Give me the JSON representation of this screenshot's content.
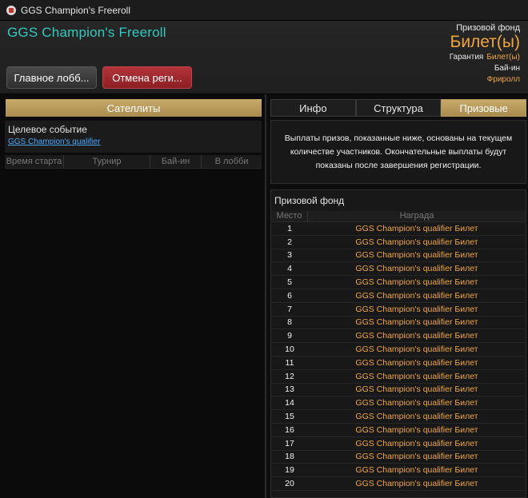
{
  "window": {
    "title": "GGS Champion's Freeroll"
  },
  "header": {
    "tournament_name": "GGS Champion's Freeroll",
    "lobby_button": "Главное лобб...",
    "cancel_button": "Отмена реги...",
    "prize_fund_label": "Призовой фонд",
    "prize_fund_value": "Билет(ы)",
    "guarantee_label": "Гарантия",
    "guarantee_value": "Билет(ы)",
    "buyin_label": "Бай-ин",
    "buyin_value": "Фриролл"
  },
  "satellites": {
    "header": "Сателлиты",
    "target_event_label": "Целевое событие",
    "target_event_link": "GGS Champion's qualifier",
    "columns": [
      "Время старта",
      "Турнир",
      "Бай-ин",
      "В лобби"
    ]
  },
  "tabs": [
    {
      "label": "Инфо",
      "active": false
    },
    {
      "label": "Структура",
      "active": false
    },
    {
      "label": "Призовые",
      "active": true
    }
  ],
  "notice": "Выплаты призов, показанные ниже, основаны на текущем количестве участников. Окончательные выплаты будут показаны после завершения регистрации.",
  "prize_pool": {
    "title": "Призовой фонд",
    "col_place": "Место",
    "col_reward": "Награда",
    "rows": [
      {
        "place": "1",
        "reward": "GGS Champion's qualifier Билет"
      },
      {
        "place": "2",
        "reward": "GGS Champion's qualifier Билет"
      },
      {
        "place": "3",
        "reward": "GGS Champion's qualifier Билет"
      },
      {
        "place": "4",
        "reward": "GGS Champion's qualifier Билет"
      },
      {
        "place": "5",
        "reward": "GGS Champion's qualifier Билет"
      },
      {
        "place": "6",
        "reward": "GGS Champion's qualifier Билет"
      },
      {
        "place": "7",
        "reward": "GGS Champion's qualifier Билет"
      },
      {
        "place": "8",
        "reward": "GGS Champion's qualifier Билет"
      },
      {
        "place": "9",
        "reward": "GGS Champion's qualifier Билет"
      },
      {
        "place": "10",
        "reward": "GGS Champion's qualifier Билет"
      },
      {
        "place": "11",
        "reward": "GGS Champion's qualifier Билет"
      },
      {
        "place": "12",
        "reward": "GGS Champion's qualifier Билет"
      },
      {
        "place": "13",
        "reward": "GGS Champion's qualifier Билет"
      },
      {
        "place": "14",
        "reward": "GGS Champion's qualifier Билет"
      },
      {
        "place": "15",
        "reward": "GGS Champion's qualifier Билет"
      },
      {
        "place": "16",
        "reward": "GGS Champion's qualifier Билет"
      },
      {
        "place": "17",
        "reward": "GGS Champion's qualifier Билет"
      },
      {
        "place": "18",
        "reward": "GGS Champion's qualifier Билет"
      },
      {
        "place": "19",
        "reward": "GGS Champion's qualifier Билет"
      },
      {
        "place": "20",
        "reward": "GGS Champion's qualifier Билет"
      }
    ]
  },
  "colors": {
    "accent_teal": "#2fc9c0",
    "gold": "#f0a640",
    "tab_active": "#c8ab6a",
    "cancel_red": "#b3333a",
    "link_blue": "#4aa8ff"
  }
}
